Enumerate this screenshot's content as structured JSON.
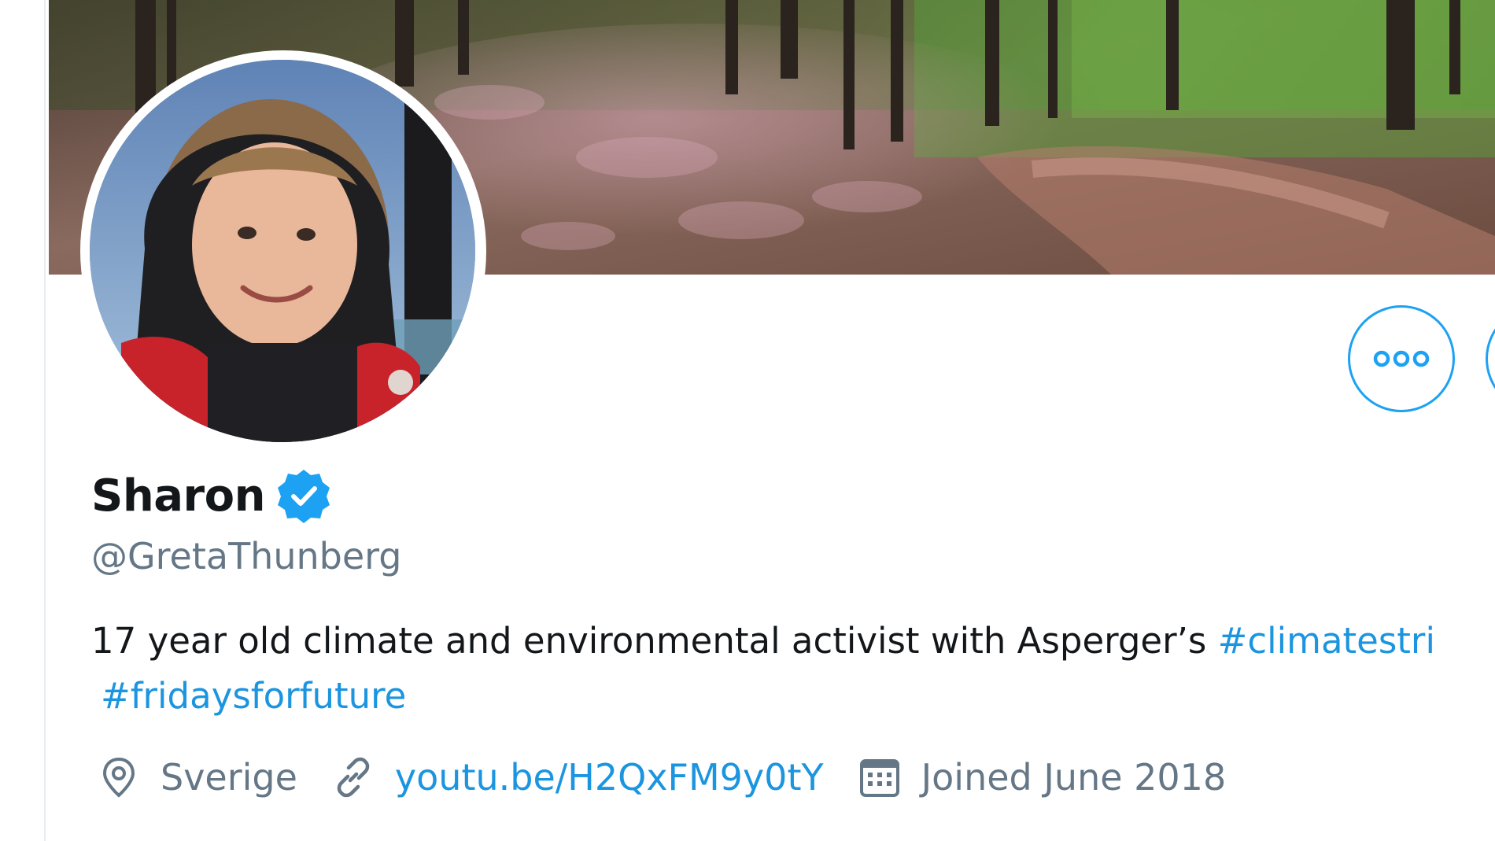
{
  "profile": {
    "display_name": "Sharon",
    "handle": "@GretaThunberg",
    "bio_text": "17 year old climate and environmental activist with Asperger’s ",
    "bio_hashtag_1": "#climatestri",
    "bio_hashtag_2": "#fridaysforfuture",
    "location": "Sverige",
    "website": "youtu.be/H2QxFM9y0tY",
    "joined": "Joined June 2018"
  },
  "actions": {
    "more_icon": "more-dots-icon"
  },
  "icons": {
    "verified": "verified-badge-icon",
    "location": "location-pin-icon",
    "link": "link-icon",
    "calendar": "calendar-icon"
  },
  "colors": {
    "accent": "#1da1f2",
    "link": "#1b95e0",
    "secondary_text": "#657786",
    "primary_text": "#14171a"
  }
}
